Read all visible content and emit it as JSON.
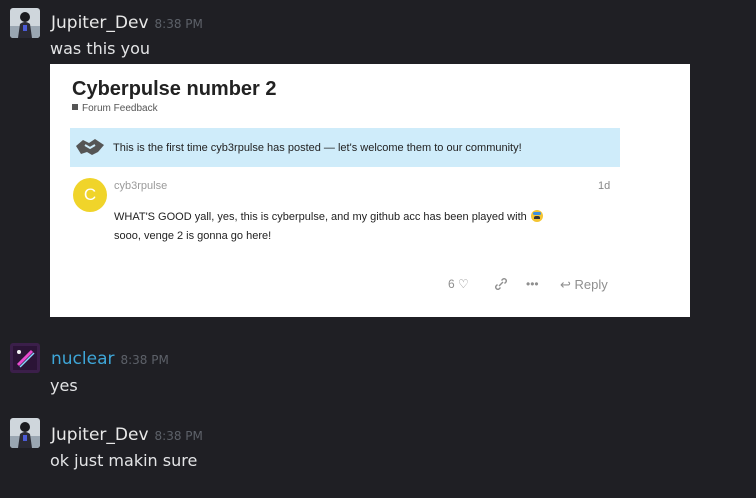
{
  "messages": [
    {
      "author": "Jupiter_Dev",
      "time": "8:38 PM",
      "text": "was this you"
    },
    {
      "author": "nuclear",
      "time": "8:38 PM",
      "text": "yes"
    },
    {
      "author": "Jupiter_Dev",
      "time": "8:38 PM",
      "text": "ok just makin sure"
    }
  ],
  "embed": {
    "title": "Cyberpulse number 2",
    "category": "Forum Feedback",
    "banner": "This is the first time cyb3rpulse has posted — let's welcome them to our community!",
    "avatar_letter": "C",
    "username": "cyb3rpulse",
    "age": "1d",
    "body_line1": "WHAT'S GOOD yall, yes, this is cyberpulse, and my github acc has been played with",
    "body_line2": "sooo, venge 2 is gonna go here!",
    "likes": "6",
    "reply_label": "Reply"
  },
  "colors": {
    "background": "#1f1f24",
    "username_blue": "#3ea6d8",
    "banner": "#cfecfa",
    "avatar_yellow": "#f0d42a"
  }
}
